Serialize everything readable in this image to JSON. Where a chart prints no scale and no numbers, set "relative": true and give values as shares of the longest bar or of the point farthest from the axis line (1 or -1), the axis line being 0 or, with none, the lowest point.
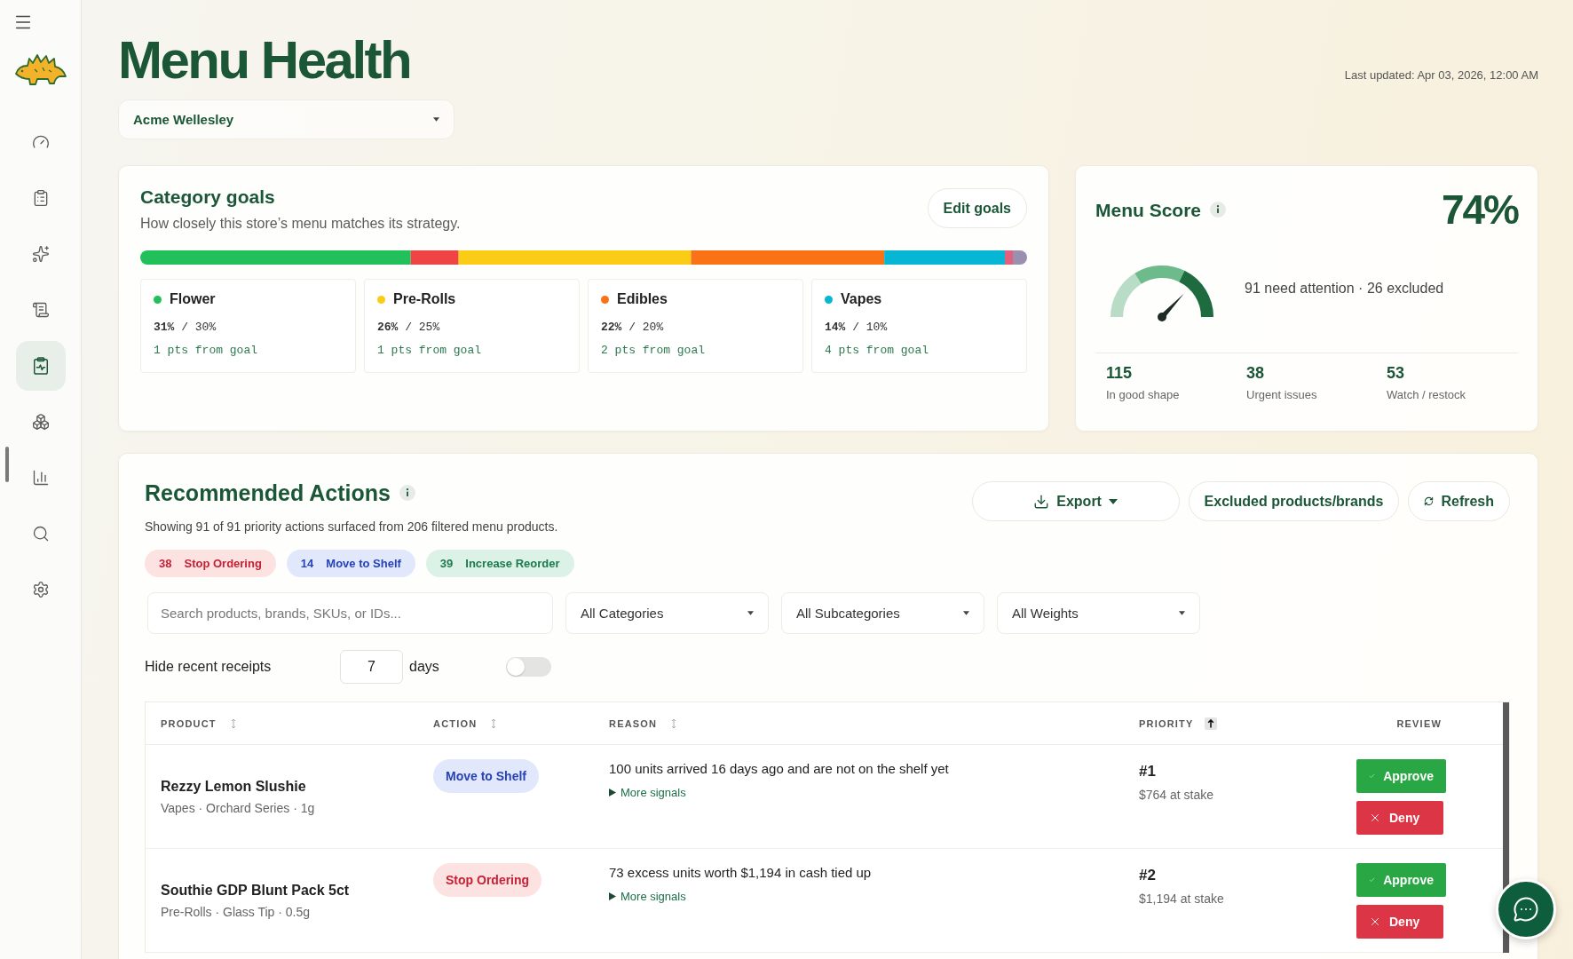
{
  "sidebar": {
    "items": [
      {
        "selected": false
      },
      {
        "selected": false
      },
      {
        "selected": false
      },
      {
        "selected": false
      },
      {
        "selected": true
      },
      {
        "selected": false
      },
      {
        "selected": false
      },
      {
        "selected": false
      },
      {
        "selected": false
      }
    ]
  },
  "header": {
    "title": "Menu Health",
    "store_select": {
      "value": "Acme Wellesley"
    },
    "last_updated": "Last updated: Apr 03, 2026, 12:00 AM"
  },
  "category_goals": {
    "title": "Category goals",
    "subtitle": "How closely this store’s menu matches its strategy.",
    "edit_button": "Edit goals",
    "chart_data": {
      "type": "bar",
      "orientation": "horizontal",
      "stacked": true,
      "relative": true,
      "series": [
        {
          "color": "#22c05a",
          "values": [
            0.305
          ]
        },
        {
          "color": "#ef4444",
          "values": [
            0.054
          ]
        },
        {
          "color": "#facc15",
          "values": [
            0.262
          ]
        },
        {
          "color": "#f97316",
          "values": [
            0.218
          ]
        },
        {
          "color": "#06b6d4",
          "values": [
            0.136
          ]
        },
        {
          "color": "#e0607e",
          "values": [
            0.009
          ]
        },
        {
          "color": "#9a8fb0",
          "values": [
            0.016
          ]
        }
      ]
    },
    "categories": [
      {
        "name": "Flower",
        "color": "#22c05a",
        "ratio": "**31%** / 30%",
        "gap": "1 pts from goal"
      },
      {
        "name": "Pre-Rolls",
        "color": "#facc15",
        "ratio": "**26%** / 25%",
        "gap": "1 pts from goal"
      },
      {
        "name": "Edibles",
        "color": "#f97316",
        "ratio": "**22%** / 20%",
        "gap": "2 pts from goal"
      },
      {
        "name": "Vapes",
        "color": "#06b6d4",
        "ratio": "**14%** / 10%",
        "gap": "4 pts from goal"
      }
    ]
  },
  "menu_score": {
    "title": "Menu Score",
    "score": "74%",
    "gauge": {
      "level": 0.74
    },
    "summary": "91 need attention · 26 excluded",
    "stats": [
      {
        "value": "115",
        "label": "In good shape"
      },
      {
        "value": "38",
        "label": "Urgent issues"
      },
      {
        "value": "53",
        "label": "Watch / restock"
      }
    ]
  },
  "recommended_actions": {
    "title": "Recommended Actions",
    "subtitle": "Showing 91 of 91 priority actions surfaced from 206 filtered menu products.",
    "buttons": [
      {
        "kind": "export",
        "label": "Export"
      },
      {
        "kind": "plain",
        "label": "Excluded products/brands"
      },
      {
        "kind": "refresh",
        "label": "Refresh"
      }
    ],
    "summary_pills": [
      {
        "kind": "stop",
        "count": "38",
        "label": "Stop Ordering"
      },
      {
        "kind": "move",
        "count": "14",
        "label": "Move to Shelf"
      },
      {
        "kind": "increase",
        "count": "39",
        "label": "Increase Reorder"
      }
    ],
    "search": {
      "placeholder": "Search products, brands, SKUs, or IDs..."
    },
    "filters": [
      {
        "value": "All Categories"
      },
      {
        "value": "All Subcategories"
      },
      {
        "value": "All Weights"
      }
    ],
    "hide_recent_receipts": {
      "label": "Hide recent receipts",
      "value": "7",
      "unit": "days",
      "on": false
    },
    "table": {
      "columns": [
        {
          "label": "PRODUCT",
          "sorted": false
        },
        {
          "label": "ACTION",
          "sorted": false
        },
        {
          "label": "REASON",
          "sorted": false
        },
        {
          "label": "PRIORITY",
          "sorted": true
        },
        {
          "label": "REVIEW"
        }
      ],
      "rows": [
        {
          "product": "Rezzy Lemon Slushie",
          "details": "Vapes · Orchard Series · 1g",
          "action": {
            "kind": "move",
            "label": "Move to Shelf"
          },
          "reason": "100 units arrived 16 days ago and are not on the shelf yet",
          "more_signals": {
            "label": "More signals",
            "expanded": false
          },
          "priority": "#1",
          "at_stake": "$764 at stake",
          "approve": "Approve",
          "deny": "Deny"
        },
        {
          "product": "Southie GDP Blunt Pack 5ct",
          "details": "Pre-Rolls · Glass Tip · 0.5g",
          "action": {
            "kind": "stop",
            "label": "Stop Ordering"
          },
          "reason": "73 excess units worth $1,194 in cash tied up",
          "more_signals": {
            "label": "More signals",
            "expanded": false
          },
          "priority": "#2",
          "at_stake": "$1,194 at stake",
          "approve": "Approve",
          "deny": "Deny"
        }
      ]
    }
  }
}
